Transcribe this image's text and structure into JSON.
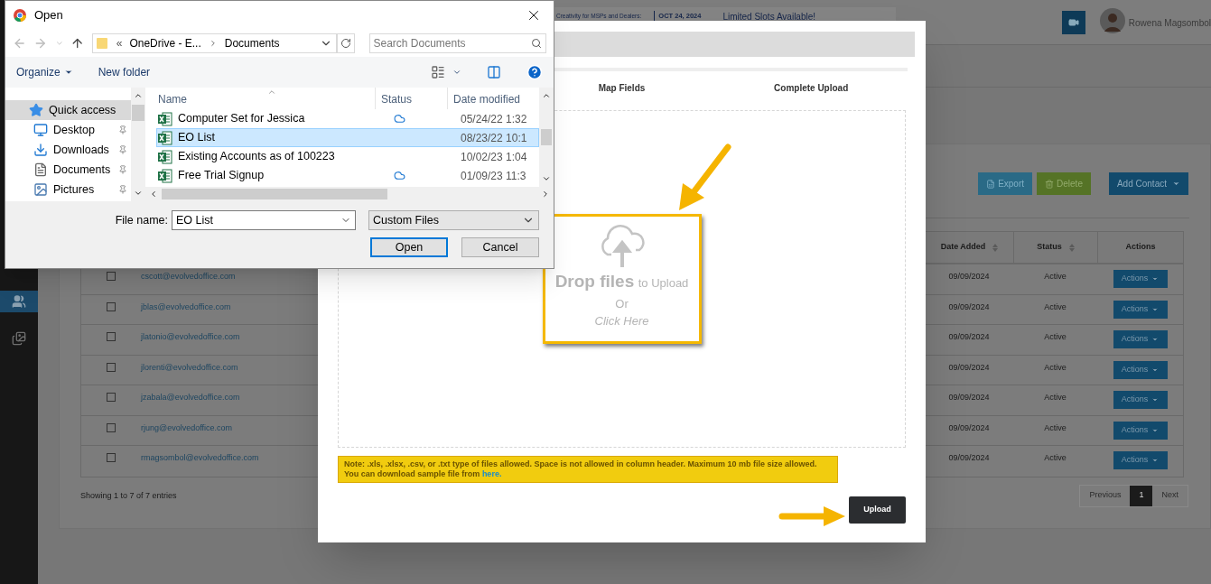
{
  "app": {
    "banner": {
      "headline": "Creativity for MSPs and Dealers:",
      "date": "OCT 24, 2024",
      "tagline": "Limited Slots Available!"
    },
    "user_name": "Rowena Magsombol",
    "sidebar": {
      "items": [
        {
          "kind": "contacts",
          "selected": true
        },
        {
          "kind": "gallery",
          "selected": false
        }
      ]
    },
    "toolbar_buttons": [
      {
        "kind": "export",
        "label": "Export"
      },
      {
        "kind": "delete",
        "label": "Delete"
      },
      {
        "kind": "add",
        "label": "Add Contact"
      }
    ],
    "table": {
      "columns": [
        {
          "label": "Date Added",
          "sortable": true
        },
        {
          "label": "Status",
          "sortable": true
        },
        {
          "label": "Actions",
          "sortable": false
        }
      ],
      "rows": [
        {
          "checked": false,
          "email": "cscott@evolvedoffice.com",
          "date_added": "09/09/2024",
          "status": "Active",
          "action": "Actions"
        },
        {
          "checked": false,
          "email": "jblas@evolvedoffice.com",
          "date_added": "09/09/2024",
          "status": "Active",
          "action": "Actions"
        },
        {
          "checked": false,
          "email": "jlatonio@evolvedoffice.com",
          "date_added": "09/09/2024",
          "status": "Active",
          "action": "Actions"
        },
        {
          "checked": false,
          "email": "jlorenti@evolvedoffice.com",
          "date_added": "09/09/2024",
          "status": "Active",
          "action": "Actions"
        },
        {
          "checked": false,
          "email": "jzabala@evolvedoffice.com",
          "date_added": "09/09/2024",
          "status": "Active",
          "action": "Actions"
        },
        {
          "checked": false,
          "email": "rjung@evolvedoffice.com",
          "date_added": "09/09/2024",
          "status": "Active",
          "action": "Actions"
        },
        {
          "checked": false,
          "email": "rmagsombol@evolvedoffice.com",
          "date_added": "09/09/2024",
          "status": "Active",
          "action": "Actions"
        }
      ]
    },
    "table_info": "Showing 1 to 7 of 7 entries",
    "pagination": [
      {
        "label": "Previous",
        "selected": false
      },
      {
        "label": "1",
        "selected": true
      },
      {
        "label": "Next",
        "selected": false
      }
    ]
  },
  "modal": {
    "steps": [
      {
        "label": "Map Fields"
      },
      {
        "label": "Complete Upload"
      }
    ],
    "dropzone": {
      "title": "Drop files",
      "subtitle": "to Upload",
      "separator": "Or",
      "action": "Click Here"
    },
    "note": "Note: .xls, .xlsx, .csv, or .txt type of files allowed. Space is not allowed in column header. Maximum 10 mb file size allowed.",
    "note_line2": "You can download sample file from",
    "note_link": "here.",
    "upload_button": "Upload"
  },
  "file_dialog": {
    "title": "Open",
    "overflow_mark": "«",
    "path": [
      "OneDrive - E...",
      "Documents"
    ],
    "search": {
      "placeholder": "Search Documents"
    },
    "toolbar": [
      "Organize",
      "New folder"
    ],
    "nav": [
      {
        "label": "Quick access",
        "kind": "star",
        "selected": true,
        "pinned": false
      },
      {
        "label": "Desktop",
        "kind": "desktop",
        "selected": false,
        "pinned": true
      },
      {
        "label": "Downloads",
        "kind": "downloads",
        "selected": false,
        "pinned": true
      },
      {
        "label": "Documents",
        "kind": "documents",
        "selected": false,
        "pinned": true
      },
      {
        "label": "Pictures",
        "kind": "pictures",
        "selected": false,
        "pinned": true
      }
    ],
    "columns": [
      "Name",
      "Status",
      "Date modified"
    ],
    "files": [
      {
        "name": "Computer Set for Jessica",
        "synced": true,
        "date": "05/24/22 1:32",
        "selected": false
      },
      {
        "name": "EO List",
        "synced": false,
        "date": "08/23/22 10:1",
        "selected": true
      },
      {
        "name": "Existing Accounts as of 100223",
        "synced": false,
        "date": "10/02/23 1:04",
        "selected": false
      },
      {
        "name": "Free Trial Signup",
        "synced": true,
        "date": "01/09/23 11:3",
        "selected": false
      }
    ],
    "file_name_label": "File name:",
    "file_name": "EO List",
    "file_type": "Custom Files",
    "buttons": [
      {
        "label": "Open",
        "kind": "primary"
      },
      {
        "label": "Cancel",
        "kind": "secondary"
      }
    ]
  }
}
